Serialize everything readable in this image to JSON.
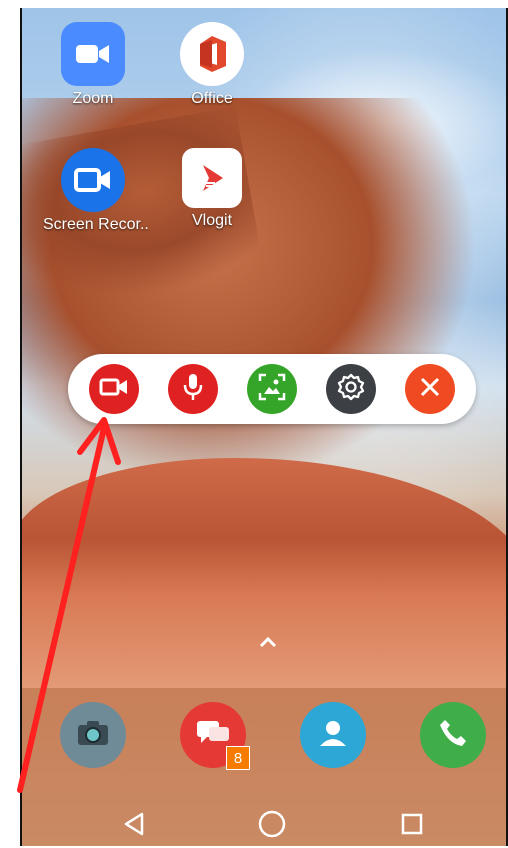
{
  "home_apps": [
    {
      "label": "Zoom",
      "icon": "zoom-video-icon",
      "color": "#4a8cff"
    },
    {
      "label": "Office",
      "icon": "office-icon",
      "color": "#e2482b"
    },
    {
      "label": "Screen Recor..",
      "icon": "video-camera-icon",
      "color": "#1a73e8"
    },
    {
      "label": "Vlogit",
      "icon": "vlogit-icon",
      "color": "#e53935"
    }
  ],
  "toolbar": {
    "buttons": [
      {
        "name": "record",
        "icon": "video-camera-icon",
        "color": "#e02121"
      },
      {
        "name": "microphone",
        "icon": "microphone-icon",
        "color": "#e02121"
      },
      {
        "name": "screenshot",
        "icon": "image-frame-icon",
        "color": "#35a52a"
      },
      {
        "name": "settings",
        "icon": "gear-icon",
        "color": "#3c3f44"
      },
      {
        "name": "close",
        "icon": "close-icon",
        "color": "#ef4a22"
      }
    ]
  },
  "dock": [
    {
      "name": "camera",
      "icon": "camera-icon",
      "color": "#6f8b98"
    },
    {
      "name": "messages",
      "icon": "chat-icon",
      "color": "#e53935",
      "badge": "8"
    },
    {
      "name": "contacts",
      "icon": "person-icon",
      "color": "#2ca7d6"
    },
    {
      "name": "phone",
      "icon": "phone-icon",
      "color": "#3fae49"
    }
  ],
  "navbar": {
    "back": "back-icon",
    "home": "home-icon",
    "recents": "recents-icon"
  },
  "annotation": {
    "color": "#ff2020"
  }
}
